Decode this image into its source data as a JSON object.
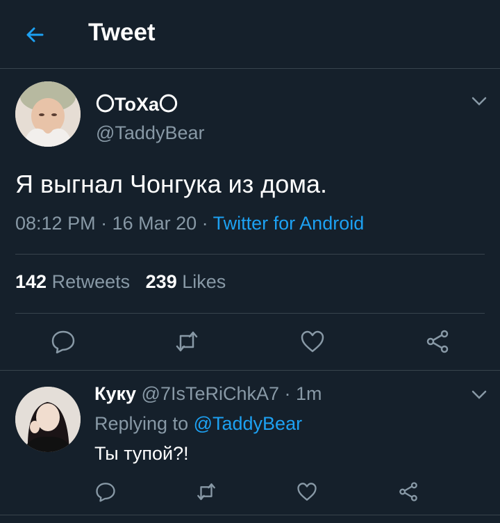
{
  "header": {
    "title": "Tweet",
    "back_icon": "arrow-left-icon"
  },
  "tweet": {
    "display_name": "〇ToXa〇",
    "handle": "@TaddyBear",
    "text": "Я выгнал Чонгука из дома.",
    "time": "08:12 PM · 16 Mar 20 · ",
    "source": "Twitter for Android",
    "retweets_count": "142",
    "retweets_label": "Retweets",
    "likes_count": "239",
    "likes_label": "Likes"
  },
  "reply": {
    "display_name": "Куку",
    "handle_time": " @7IsTeRiChkA7 · 1m",
    "replying_label": "Replying to ",
    "replying_to": "@TaddyBear",
    "text": "Ты тупой?!"
  },
  "colors": {
    "background": "#15202b",
    "accent": "#1da1f2",
    "muted": "#8899a6",
    "divider": "#38444d"
  }
}
